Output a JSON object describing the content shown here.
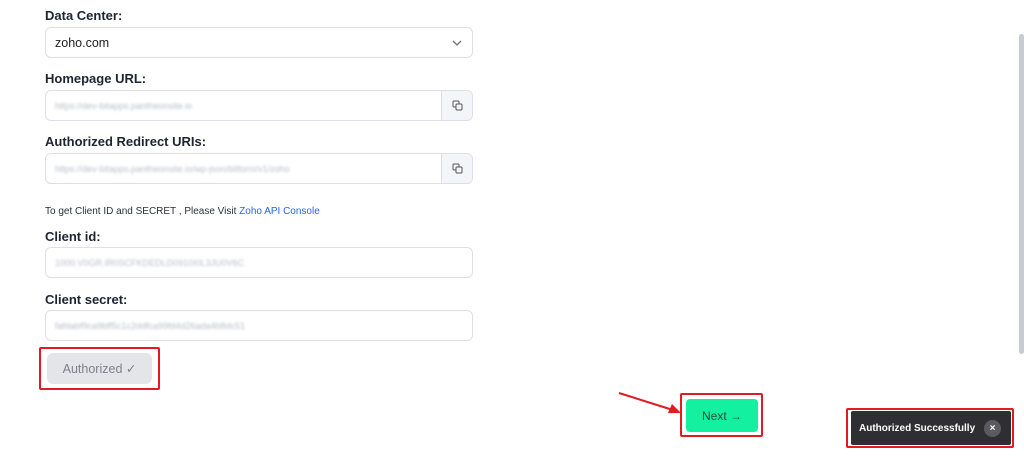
{
  "form": {
    "data_center": {
      "label": "Data Center:",
      "value": "zoho.com"
    },
    "homepage_url": {
      "label": "Homepage URL:",
      "value": "https://dev-bitapps.pantheonsite.io"
    },
    "redirect_uris": {
      "label": "Authorized Redirect URIs:",
      "value": "https://dev-bitapps.pantheonsite.io/wp-json/bitform/v1/zoho"
    },
    "hint": {
      "text": "To get Client ID and SECRET , Please Visit ",
      "link": "Zoho API Console"
    },
    "client_id": {
      "label": "Client id:",
      "value": "1000.V0GR.IR0SCFKDEDLD0910I0L3JU0V6C"
    },
    "client_secret": {
      "label": "Client secret:",
      "value": "fafdabf9ca9bff5c1c2ddfca99fd4d26ada4b8dc51"
    },
    "authorized_button": "Authorized ✓"
  },
  "next_button": "Next →",
  "toast": {
    "message": "Authorized Successfully",
    "close": "×"
  },
  "colors": {
    "accent_green": "#13f0a0",
    "highlight_red": "#e11b22",
    "link_blue": "#2b63e0",
    "toast_bg": "#2f2f33"
  }
}
